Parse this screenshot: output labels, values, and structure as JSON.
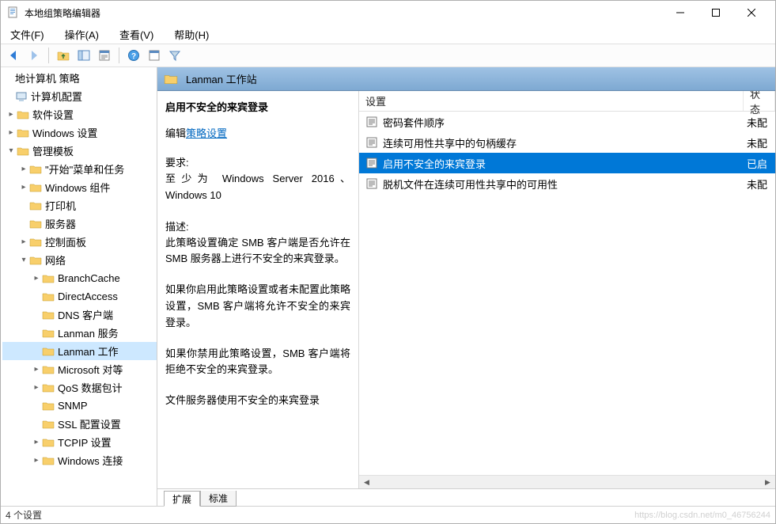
{
  "window": {
    "title": "本地组策略编辑器"
  },
  "menu": {
    "file": "文件(F)",
    "action": "操作(A)",
    "view": "查看(V)",
    "help": "帮助(H)"
  },
  "tree": {
    "root": "地计算机 策略",
    "computer_config": "计算机配置",
    "software": "软件设置",
    "windows": "Windows 设置",
    "admin_templates": "管理模板",
    "start_menu": "\"开始\"菜单和任务",
    "win_components": "Windows 组件",
    "printers": "打印机",
    "servers": "服务器",
    "control_panel": "控制面板",
    "network": "网络",
    "branchcache": "BranchCache",
    "directaccess": "DirectAccess",
    "dns_client": "DNS 客户端",
    "lanman_server": "Lanman 服务",
    "lanman_workstation": "Lanman 工作",
    "ms_pair": "Microsoft 对等",
    "qos": "QoS 数据包计",
    "snmp": "SNMP",
    "ssl": "SSL 配置设置",
    "tcpip": "TCPIP 设置",
    "win_conn": "Windows 连接"
  },
  "right_header": {
    "title": "Lanman 工作站"
  },
  "desc": {
    "title": "启用不安全的来宾登录",
    "edit_prefix": "编辑",
    "edit_link": "策略设置",
    "req_label": "要求:",
    "req_text": "至少为 Windows Server 2016、Windows 10",
    "desc_label": "描述:",
    "p1": "此策略设置确定 SMB 客户端是否允许在 SMB 服务器上进行不安全的来宾登录。",
    "p2": "如果你启用此策略设置或者未配置此策略设置，SMB 客户端将允许不安全的来宾登录。",
    "p3": "如果你禁用此策略设置，SMB 客户端将拒绝不安全的来宾登录。",
    "p4": "文件服务器使用不安全的来宾登录"
  },
  "list": {
    "header_setting": "设置",
    "header_state": "状态",
    "rows": [
      {
        "setting": "密码套件顺序",
        "state": "未配"
      },
      {
        "setting": "连续可用性共享中的句柄缓存",
        "state": "未配"
      },
      {
        "setting": "启用不安全的来宾登录",
        "state": "已启"
      },
      {
        "setting": "脱机文件在连续可用性共享中的可用性",
        "state": "未配"
      }
    ]
  },
  "tabs": {
    "extended": "扩展",
    "standard": "标准"
  },
  "status": {
    "text": "4 个设置",
    "watermark": "https://blog.csdn.net/m0_46756244"
  }
}
